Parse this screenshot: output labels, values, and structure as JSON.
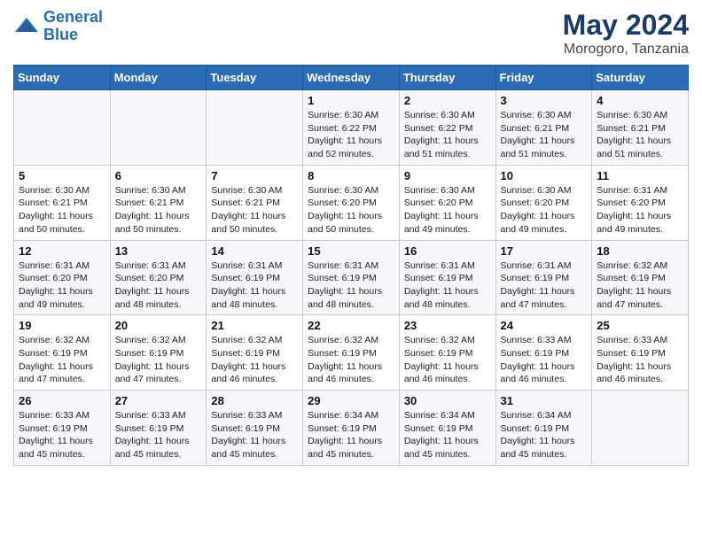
{
  "logo": {
    "line1": "General",
    "line2": "Blue"
  },
  "title": "May 2024",
  "subtitle": "Morogoro, Tanzania",
  "days_of_week": [
    "Sunday",
    "Monday",
    "Tuesday",
    "Wednesday",
    "Thursday",
    "Friday",
    "Saturday"
  ],
  "weeks": [
    [
      {
        "day": "",
        "info": ""
      },
      {
        "day": "",
        "info": ""
      },
      {
        "day": "",
        "info": ""
      },
      {
        "day": "1",
        "info": "Sunrise: 6:30 AM\nSunset: 6:22 PM\nDaylight: 11 hours and 52 minutes."
      },
      {
        "day": "2",
        "info": "Sunrise: 6:30 AM\nSunset: 6:22 PM\nDaylight: 11 hours and 51 minutes."
      },
      {
        "day": "3",
        "info": "Sunrise: 6:30 AM\nSunset: 6:21 PM\nDaylight: 11 hours and 51 minutes."
      },
      {
        "day": "4",
        "info": "Sunrise: 6:30 AM\nSunset: 6:21 PM\nDaylight: 11 hours and 51 minutes."
      }
    ],
    [
      {
        "day": "5",
        "info": "Sunrise: 6:30 AM\nSunset: 6:21 PM\nDaylight: 11 hours and 50 minutes."
      },
      {
        "day": "6",
        "info": "Sunrise: 6:30 AM\nSunset: 6:21 PM\nDaylight: 11 hours and 50 minutes."
      },
      {
        "day": "7",
        "info": "Sunrise: 6:30 AM\nSunset: 6:21 PM\nDaylight: 11 hours and 50 minutes."
      },
      {
        "day": "8",
        "info": "Sunrise: 6:30 AM\nSunset: 6:20 PM\nDaylight: 11 hours and 50 minutes."
      },
      {
        "day": "9",
        "info": "Sunrise: 6:30 AM\nSunset: 6:20 PM\nDaylight: 11 hours and 49 minutes."
      },
      {
        "day": "10",
        "info": "Sunrise: 6:30 AM\nSunset: 6:20 PM\nDaylight: 11 hours and 49 minutes."
      },
      {
        "day": "11",
        "info": "Sunrise: 6:31 AM\nSunset: 6:20 PM\nDaylight: 11 hours and 49 minutes."
      }
    ],
    [
      {
        "day": "12",
        "info": "Sunrise: 6:31 AM\nSunset: 6:20 PM\nDaylight: 11 hours and 49 minutes."
      },
      {
        "day": "13",
        "info": "Sunrise: 6:31 AM\nSunset: 6:20 PM\nDaylight: 11 hours and 48 minutes."
      },
      {
        "day": "14",
        "info": "Sunrise: 6:31 AM\nSunset: 6:19 PM\nDaylight: 11 hours and 48 minutes."
      },
      {
        "day": "15",
        "info": "Sunrise: 6:31 AM\nSunset: 6:19 PM\nDaylight: 11 hours and 48 minutes."
      },
      {
        "day": "16",
        "info": "Sunrise: 6:31 AM\nSunset: 6:19 PM\nDaylight: 11 hours and 48 minutes."
      },
      {
        "day": "17",
        "info": "Sunrise: 6:31 AM\nSunset: 6:19 PM\nDaylight: 11 hours and 47 minutes."
      },
      {
        "day": "18",
        "info": "Sunrise: 6:32 AM\nSunset: 6:19 PM\nDaylight: 11 hours and 47 minutes."
      }
    ],
    [
      {
        "day": "19",
        "info": "Sunrise: 6:32 AM\nSunset: 6:19 PM\nDaylight: 11 hours and 47 minutes."
      },
      {
        "day": "20",
        "info": "Sunrise: 6:32 AM\nSunset: 6:19 PM\nDaylight: 11 hours and 47 minutes."
      },
      {
        "day": "21",
        "info": "Sunrise: 6:32 AM\nSunset: 6:19 PM\nDaylight: 11 hours and 46 minutes."
      },
      {
        "day": "22",
        "info": "Sunrise: 6:32 AM\nSunset: 6:19 PM\nDaylight: 11 hours and 46 minutes."
      },
      {
        "day": "23",
        "info": "Sunrise: 6:32 AM\nSunset: 6:19 PM\nDaylight: 11 hours and 46 minutes."
      },
      {
        "day": "24",
        "info": "Sunrise: 6:33 AM\nSunset: 6:19 PM\nDaylight: 11 hours and 46 minutes."
      },
      {
        "day": "25",
        "info": "Sunrise: 6:33 AM\nSunset: 6:19 PM\nDaylight: 11 hours and 46 minutes."
      }
    ],
    [
      {
        "day": "26",
        "info": "Sunrise: 6:33 AM\nSunset: 6:19 PM\nDaylight: 11 hours and 45 minutes."
      },
      {
        "day": "27",
        "info": "Sunrise: 6:33 AM\nSunset: 6:19 PM\nDaylight: 11 hours and 45 minutes."
      },
      {
        "day": "28",
        "info": "Sunrise: 6:33 AM\nSunset: 6:19 PM\nDaylight: 11 hours and 45 minutes."
      },
      {
        "day": "29",
        "info": "Sunrise: 6:34 AM\nSunset: 6:19 PM\nDaylight: 11 hours and 45 minutes."
      },
      {
        "day": "30",
        "info": "Sunrise: 6:34 AM\nSunset: 6:19 PM\nDaylight: 11 hours and 45 minutes."
      },
      {
        "day": "31",
        "info": "Sunrise: 6:34 AM\nSunset: 6:19 PM\nDaylight: 11 hours and 45 minutes."
      },
      {
        "day": "",
        "info": ""
      }
    ]
  ]
}
